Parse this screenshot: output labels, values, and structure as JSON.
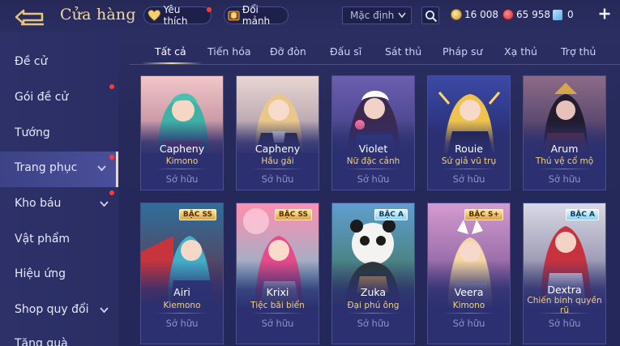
{
  "header": {
    "back_icon": "back-arrow-icon",
    "title": "Cửa hàng",
    "favorites_label": "Yêu thích",
    "shards_label": "Đổi mảnh",
    "sort_value": "Mặc định",
    "currencies": {
      "gold": "16 008",
      "ruby": "65 958",
      "voucher": "0"
    },
    "colors": {
      "title": "#f2d9a0",
      "notify_dot": "#ff3a3a"
    }
  },
  "sidebar": {
    "items": [
      {
        "label": "Đề cử"
      },
      {
        "label": "Gói đề cử"
      },
      {
        "label": "Tướng"
      },
      {
        "label": "Trang phục"
      },
      {
        "label": "Kho báu"
      },
      {
        "label": "Vật phẩm"
      },
      {
        "label": "Hiệu ứng"
      },
      {
        "label": "Shop quy đổi"
      },
      {
        "label": "Tặng quà"
      }
    ]
  },
  "tabs": [
    {
      "label": "Tất cả"
    },
    {
      "label": "Tiến hóa"
    },
    {
      "label": "Đỡ đòn"
    },
    {
      "label": "Đấu sĩ"
    },
    {
      "label": "Sát thủ"
    },
    {
      "label": "Pháp sư"
    },
    {
      "label": "Xạ thủ"
    },
    {
      "label": "Trợ thủ"
    }
  ],
  "cards": [
    {
      "hero": "Capheny",
      "skin": "Kimono",
      "status": "Sở hữu",
      "badge": ""
    },
    {
      "hero": "Capheny",
      "skin": "Hầu gái",
      "status": "Sở hữu",
      "badge": ""
    },
    {
      "hero": "Violet",
      "skin": "Nữ đặc cảnh",
      "status": "Sở hữu",
      "badge": ""
    },
    {
      "hero": "Rouie",
      "skin": "Sứ giả vũ trụ",
      "status": "Sở hữu",
      "badge": ""
    },
    {
      "hero": "Arum",
      "skin": "Thú vệ cổ mộ",
      "status": "Sở hữu",
      "badge": ""
    },
    {
      "hero": "Airi",
      "skin": "Kiemono",
      "status": "Sở hữu",
      "badge": "BẬC SS"
    },
    {
      "hero": "Krixi",
      "skin": "Tiệc bãi biển",
      "status": "Sở hữu",
      "badge": "BẬC SS"
    },
    {
      "hero": "Zuka",
      "skin": "Đại phú ông",
      "status": "Sở hữu",
      "badge": "BẬC A"
    },
    {
      "hero": "Veera",
      "skin": "Kimono",
      "status": "Sở hữu",
      "badge": "BẬC S+"
    },
    {
      "hero": "Dextra",
      "skin": "Chiến binh quyền rũ",
      "status": "Sở hữu",
      "badge": "BẬC A"
    }
  ]
}
